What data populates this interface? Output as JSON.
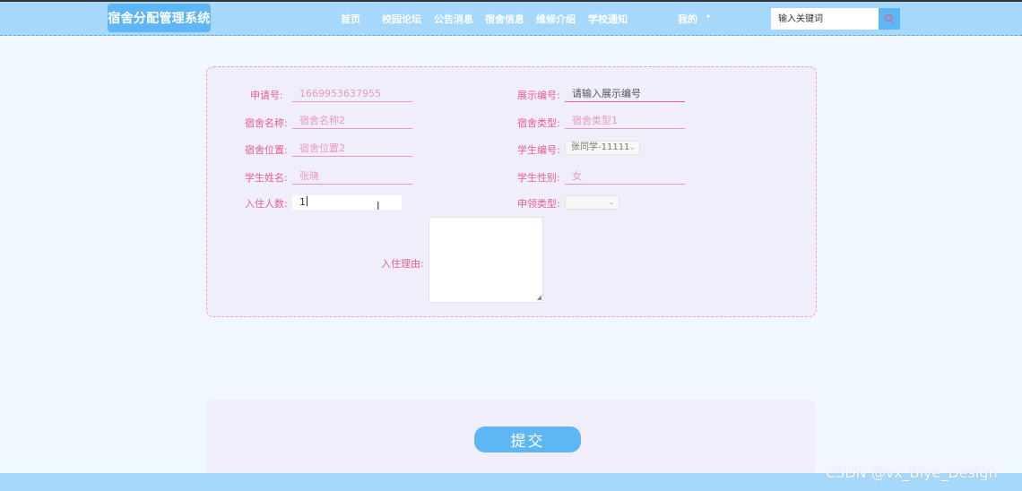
{
  "header": {
    "logo": "宿舍分配管理系统",
    "nav": [
      "首页",
      "校园论坛",
      "公告消息",
      "宿舍信息",
      "维修介绍",
      "学校通知",
      "我的"
    ],
    "search_placeholder": "输入关键词",
    "search_icon": "search-icon",
    "user_menu_arrow": "▾"
  },
  "form": {
    "apply_no": {
      "label": "申请号:",
      "value": "1669953637955"
    },
    "display_no": {
      "label": "展示编号:",
      "value": "请输入展示编号"
    },
    "dorm_name": {
      "label": "宿舍名称:",
      "value": "宿舍名称2"
    },
    "dorm_type": {
      "label": "宿舍类型:",
      "value": "宿舍类型1"
    },
    "dorm_location": {
      "label": "宿舍位置:",
      "value": "宿舍位置2"
    },
    "student_no": {
      "label": "学生编号:",
      "value": "张同学-11111"
    },
    "student_name": {
      "label": "学生姓名:",
      "value": "张晓"
    },
    "student_gender": {
      "label": "学生性别:",
      "value": "女"
    },
    "occupants": {
      "label": "入住人数:",
      "value": "1"
    },
    "apply_type": {
      "label": "申领类型:",
      "value": ""
    },
    "reason": {
      "label": "入住理由:",
      "value": ""
    }
  },
  "submit_label": "提交",
  "watermark": "CSDN @vx_Biye_Design",
  "colors": {
    "header_bg": "#a6d8fb",
    "accent": "#5eb6f2",
    "label": "#e75f8c",
    "card_bg": "#f1eefb"
  }
}
